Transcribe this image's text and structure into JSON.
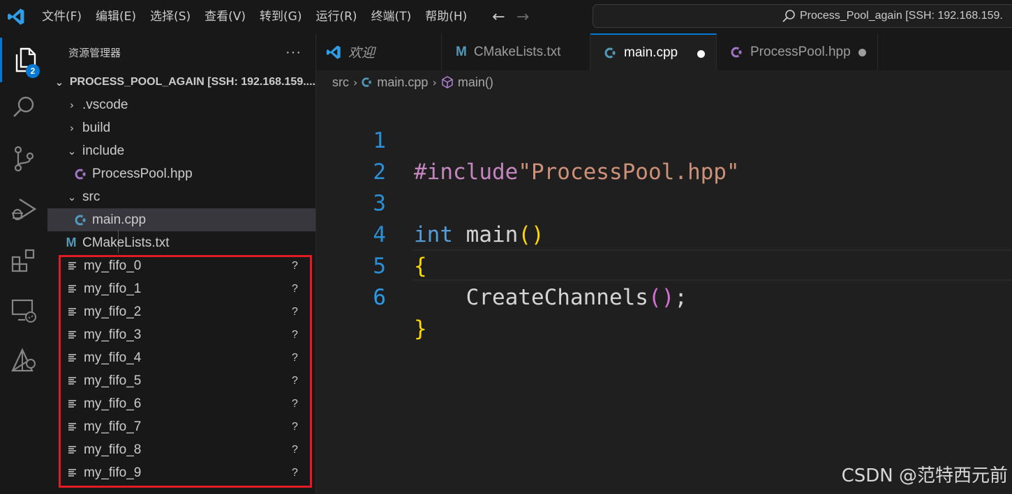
{
  "titlebar": {
    "menus": [
      "文件(F)",
      "编辑(E)",
      "选择(S)",
      "查看(V)",
      "转到(G)",
      "运行(R)",
      "终端(T)",
      "帮助(H)"
    ],
    "back_icon": "arrow-left-icon",
    "forward_icon": "arrow-right-icon",
    "command_center_text": "Process_Pool_again [SSH: 192.168.159."
  },
  "activitybar": {
    "items": [
      "explorer-icon",
      "search-icon",
      "source-control-icon",
      "run-debug-icon",
      "extensions-icon",
      "remote-explorer-icon",
      "cmake-icon"
    ],
    "explorer_badge": "2"
  },
  "sidebar": {
    "title": "资源管理器",
    "more": "···",
    "root_label": "PROCESS_POOL_AGAIN [SSH: 192.168.159....",
    "tree": {
      "vscode": ".vscode",
      "build": "build",
      "include": "include",
      "processpool": "ProcessPool.hpp",
      "src": "src",
      "main": "main.cpp",
      "cmake": "CMakeLists.txt"
    },
    "fifos": [
      {
        "name": "my_fifo_0",
        "status": "?"
      },
      {
        "name": "my_fifo_1",
        "status": "?"
      },
      {
        "name": "my_fifo_2",
        "status": "?"
      },
      {
        "name": "my_fifo_3",
        "status": "?"
      },
      {
        "name": "my_fifo_4",
        "status": "?"
      },
      {
        "name": "my_fifo_5",
        "status": "?"
      },
      {
        "name": "my_fifo_6",
        "status": "?"
      },
      {
        "name": "my_fifo_7",
        "status": "?"
      },
      {
        "name": "my_fifo_8",
        "status": "?"
      },
      {
        "name": "my_fifo_9",
        "status": "?"
      }
    ]
  },
  "tabs": [
    {
      "label": "欢迎",
      "icon": "vscode-logo-icon"
    },
    {
      "label": "CMakeLists.txt",
      "icon": "cmake-m-icon"
    },
    {
      "label": "main.cpp",
      "icon": "cpp-file-icon"
    },
    {
      "label": "ProcessPool.hpp",
      "icon": "cpp-header-icon"
    }
  ],
  "breadcrumb": {
    "folder": "src",
    "file": "main.cpp",
    "symbol": "main()"
  },
  "code": {
    "line_numbers": [
      "1",
      "2",
      "3",
      "4",
      "5",
      "6"
    ],
    "l1_directive": "#include",
    "l1_string": "\"ProcessPool.hpp\"",
    "l3_keyword": "int",
    "l3_name": "main",
    "l3_paren": "()",
    "l4_brace": "{",
    "l5_indent": "    ",
    "l5_call": "CreateChannels",
    "l5_paren": "()",
    "l5_semi": ";",
    "l6_brace": "}"
  },
  "watermark": "CSDN @范特西元前",
  "colors": {
    "accent": "#0078d4",
    "highlight_box": "#e01b24",
    "line_number": "#2b8fd6"
  }
}
